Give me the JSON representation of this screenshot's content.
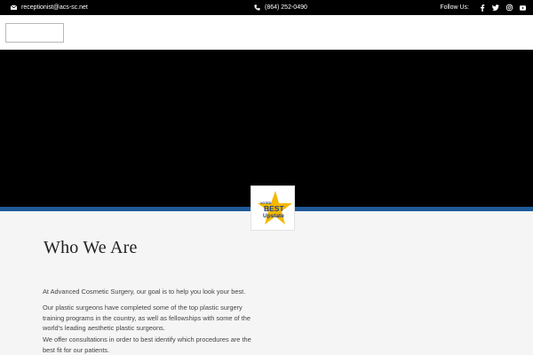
{
  "topbar": {
    "email": "receptionist@acs-sc.net",
    "phone": "(864) 252-0490",
    "follow_label": "Follow Us:",
    "social_icons": [
      "facebook-icon",
      "twitter-icon",
      "instagram-icon",
      "youtube-icon"
    ]
  },
  "colors": {
    "topbar_bg": "#000000",
    "hero_bg": "#000000",
    "accent_blue": "#1f5a9a",
    "badge_star": "#f5b800",
    "badge_text": "#1f3f8a"
  },
  "badge": {
    "line1": "VOTED",
    "line2": "BEST",
    "line3": "Upstate"
  },
  "content": {
    "heading": "Who We Are",
    "paragraphs": [
      "At Advanced Cosmetic Surgery, our goal is to help you look your best.",
      "Our plastic surgeons have completed some of the top plastic surgery training programs in the country, as well as fellowships with some of the world's leading aesthetic plastic surgeons.",
      "We offer consultations in order to best identify which procedures are the best fit for our patients."
    ]
  }
}
